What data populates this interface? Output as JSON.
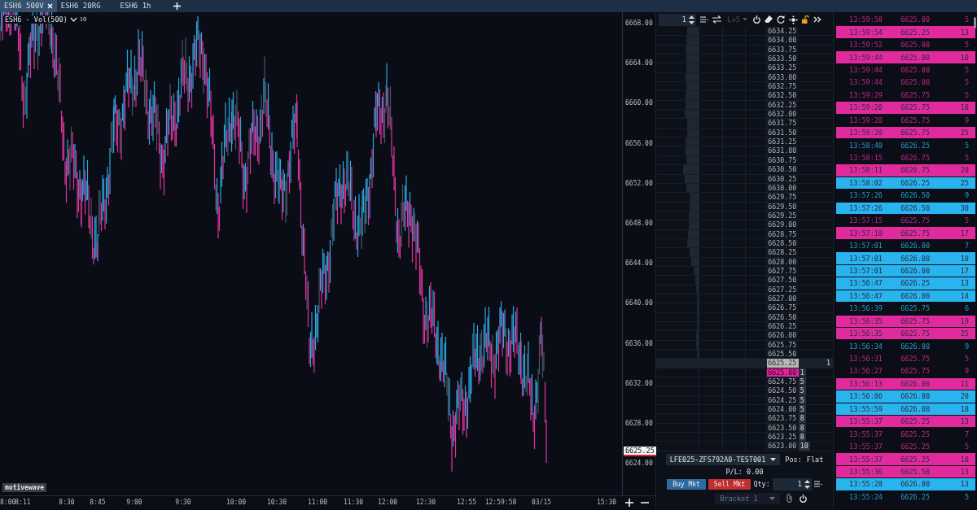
{
  "tabs": [
    {
      "label": "ESH6 500V",
      "selected": true
    },
    {
      "label": "ESH6 20RG",
      "selected": false
    },
    {
      "label": "ESH6 1h",
      "selected": false
    }
  ],
  "chart": {
    "title": "ESH6 - Vol(500)",
    "bar_setting": "10",
    "brand_label": "motivewave",
    "price_axis": [
      "6668.00",
      "6664.00",
      "6660.00",
      "6656.00",
      "6652.00",
      "6648.00",
      "6644.00",
      "6640.00",
      "6636.00",
      "6632.00",
      "6628.00",
      "6624.00"
    ],
    "last_price_tag": "6625.25",
    "time_axis": [
      "8:00",
      "8:11",
      "8:30",
      "8:45",
      "9:00",
      "9:30",
      "10:00",
      "10:30",
      "11:00",
      "11:30",
      "12:00",
      "12:30",
      "12:55",
      "12:59:58",
      "03/15",
      "15:30"
    ]
  },
  "dom": {
    "quantity": "1",
    "depth_mode": "L+5",
    "rows": [
      {
        "price": "6634.25",
        "level": 0.27,
        "last_trade": false,
        "best_bid": false
      },
      {
        "price": "6634.00",
        "level": 0.28,
        "last_trade": false,
        "best_bid": false
      },
      {
        "price": "6633.75",
        "level": 0.3,
        "last_trade": false,
        "best_bid": false
      },
      {
        "price": "6633.50",
        "level": 0.28,
        "last_trade": false,
        "best_bid": false
      },
      {
        "price": "6633.25",
        "level": 0.29,
        "last_trade": false,
        "best_bid": false
      },
      {
        "price": "6633.00",
        "level": 0.3,
        "last_trade": false,
        "best_bid": false
      },
      {
        "price": "6632.75",
        "level": 0.28,
        "last_trade": false,
        "best_bid": false
      },
      {
        "price": "6632.50",
        "level": 0.3,
        "last_trade": false,
        "best_bid": false
      },
      {
        "price": "6632.25",
        "level": 0.3,
        "last_trade": false,
        "best_bid": false
      },
      {
        "price": "6632.00",
        "level": 0.32,
        "last_trade": false,
        "best_bid": false
      },
      {
        "price": "6631.75",
        "level": 0.27,
        "last_trade": false,
        "best_bid": false
      },
      {
        "price": "6631.50",
        "level": 0.27,
        "last_trade": false,
        "best_bid": false
      },
      {
        "price": "6631.25",
        "level": 0.3,
        "last_trade": false,
        "best_bid": false
      },
      {
        "price": "6631.00",
        "level": 0.31,
        "last_trade": false,
        "best_bid": false
      },
      {
        "price": "6630.75",
        "level": 0.29,
        "last_trade": false,
        "best_bid": false
      },
      {
        "price": "6630.50",
        "level": 0.36,
        "last_trade": false,
        "best_bid": false
      },
      {
        "price": "6630.25",
        "level": 0.33,
        "last_trade": false,
        "best_bid": false
      },
      {
        "price": "6630.00",
        "level": 0.28,
        "last_trade": false,
        "best_bid": false
      },
      {
        "price": "6629.75",
        "level": 0.21,
        "last_trade": false,
        "best_bid": false
      },
      {
        "price": "6629.50",
        "level": 0.21,
        "last_trade": false,
        "best_bid": false
      },
      {
        "price": "6629.25",
        "level": 0.22,
        "last_trade": false,
        "best_bid": false
      },
      {
        "price": "6629.00",
        "level": 0.23,
        "last_trade": false,
        "best_bid": false
      },
      {
        "price": "6628.75",
        "level": 0.25,
        "last_trade": false,
        "best_bid": false
      },
      {
        "price": "6628.50",
        "level": 0.27,
        "last_trade": false,
        "best_bid": false
      },
      {
        "price": "6628.25",
        "level": 0.2,
        "last_trade": false,
        "best_bid": false
      },
      {
        "price": "6628.00",
        "level": 0.16,
        "last_trade": false,
        "best_bid": false
      },
      {
        "price": "6627.75",
        "level": 0.12,
        "last_trade": false,
        "best_bid": false
      },
      {
        "price": "6627.50",
        "level": 0.08,
        "last_trade": false,
        "best_bid": false
      },
      {
        "price": "6627.25",
        "level": 0.05,
        "last_trade": false,
        "best_bid": false
      },
      {
        "price": "6627.00",
        "level": 0.03,
        "last_trade": false,
        "best_bid": false
      },
      {
        "price": "6626.75",
        "level": 0.03,
        "last_trade": false,
        "best_bid": false
      },
      {
        "price": "6626.50",
        "level": 0.03,
        "last_trade": false,
        "best_bid": false
      },
      {
        "price": "6626.25",
        "level": 0.03,
        "last_trade": false,
        "best_bid": false
      },
      {
        "price": "6626.00",
        "level": 0.05,
        "last_trade": false,
        "best_bid": false
      },
      {
        "price": "6625.75",
        "level": 0.05,
        "last_trade": false,
        "best_bid": false
      },
      {
        "price": "6625.50",
        "level": 0.03,
        "last_trade": false,
        "best_bid": false
      },
      {
        "price": "6625.25",
        "ask": "1",
        "last_trade": true,
        "best_bid": false
      },
      {
        "price": "6625.00",
        "bid": "1",
        "last_trade": false,
        "best_bid": true
      },
      {
        "price": "6624.75",
        "bid": "5",
        "last_trade": false,
        "best_bid": false
      },
      {
        "price": "6624.50",
        "bid": "5",
        "last_trade": false,
        "best_bid": false
      },
      {
        "price": "6624.25",
        "bid": "5",
        "last_trade": false,
        "best_bid": false
      },
      {
        "price": "6624.00",
        "bid": "5",
        "last_trade": false,
        "best_bid": false
      },
      {
        "price": "6623.75",
        "bid": "8",
        "last_trade": false,
        "best_bid": false
      },
      {
        "price": "6623.50",
        "bid": "8",
        "last_trade": false,
        "best_bid": false
      },
      {
        "price": "6623.25",
        "bid": "8",
        "last_trade": false,
        "best_bid": false
      },
      {
        "price": "6623.00",
        "bid": "10",
        "last_trade": false,
        "best_bid": false
      }
    ],
    "account": "LFE025-ZFS792A0-TEST001",
    "position_label": "Pos:",
    "position": "Flat",
    "pnl": "P/L: 0.00",
    "buy_button": "Buy Mkt",
    "sell_button": "Sell Mkt",
    "qty_label": "Qty:",
    "order_qty": "1",
    "bracket": "Bracket 1"
  },
  "time_and_sales": [
    {
      "time": "13:59:58",
      "price": "6625.00",
      "size": "5",
      "buy": false,
      "large": false
    },
    {
      "time": "13:59:54",
      "price": "6625.25",
      "size": "13",
      "buy": false,
      "large": true
    },
    {
      "time": "13:59:52",
      "price": "6625.00",
      "size": "5",
      "buy": false,
      "large": false
    },
    {
      "time": "13:59:44",
      "price": "6625.00",
      "size": "10",
      "buy": false,
      "large": true
    },
    {
      "time": "13:59:44",
      "price": "6625.00",
      "size": "5",
      "buy": false,
      "large": false
    },
    {
      "time": "13:59:44",
      "price": "6625.00",
      "size": "5",
      "buy": false,
      "large": false
    },
    {
      "time": "13:59:29",
      "price": "6625.75",
      "size": "5",
      "buy": false,
      "large": false
    },
    {
      "time": "13:59:20",
      "price": "6625.75",
      "size": "10",
      "buy": false,
      "large": true
    },
    {
      "time": "13:59:20",
      "price": "6625.75",
      "size": "9",
      "buy": false,
      "large": false
    },
    {
      "time": "13:59:20",
      "price": "6625.75",
      "size": "25",
      "buy": false,
      "large": true
    },
    {
      "time": "13:58:40",
      "price": "6626.25",
      "size": "5",
      "buy": true,
      "large": false
    },
    {
      "time": "13:58:15",
      "price": "6626.75",
      "size": "5",
      "buy": false,
      "large": false
    },
    {
      "time": "13:58:11",
      "price": "6626.75",
      "size": "20",
      "buy": false,
      "large": true
    },
    {
      "time": "13:58:02",
      "price": "6626.25",
      "size": "25",
      "buy": true,
      "large": true
    },
    {
      "time": "13:57:26",
      "price": "6626.50",
      "size": "9",
      "buy": true,
      "large": false
    },
    {
      "time": "13:57:26",
      "price": "6626.50",
      "size": "30",
      "buy": true,
      "large": true
    },
    {
      "time": "13:57:15",
      "price": "6625.75",
      "size": "5",
      "buy": false,
      "large": false
    },
    {
      "time": "13:57:10",
      "price": "6625.75",
      "size": "17",
      "buy": false,
      "large": true
    },
    {
      "time": "13:57:01",
      "price": "6626.00",
      "size": "7",
      "buy": true,
      "large": false
    },
    {
      "time": "13:57:01",
      "price": "6626.00",
      "size": "10",
      "buy": true,
      "large": true
    },
    {
      "time": "13:57:01",
      "price": "6626.00",
      "size": "17",
      "buy": true,
      "large": true
    },
    {
      "time": "13:56:47",
      "price": "6626.25",
      "size": "13",
      "buy": true,
      "large": true
    },
    {
      "time": "13:56:47",
      "price": "6626.00",
      "size": "14",
      "buy": true,
      "large": true
    },
    {
      "time": "13:56:39",
      "price": "6625.75",
      "size": "6",
      "buy": true,
      "large": false
    },
    {
      "time": "13:56:35",
      "price": "6625.75",
      "size": "19",
      "buy": false,
      "large": true
    },
    {
      "time": "13:56:35",
      "price": "6625.75",
      "size": "25",
      "buy": false,
      "large": true
    },
    {
      "time": "13:56:34",
      "price": "6626.00",
      "size": "9",
      "buy": true,
      "large": false
    },
    {
      "time": "13:56:31",
      "price": "6625.75",
      "size": "5",
      "buy": false,
      "large": false
    },
    {
      "time": "13:56:27",
      "price": "6625.75",
      "size": "9",
      "buy": false,
      "large": false
    },
    {
      "time": "13:56:13",
      "price": "6626.00",
      "size": "11",
      "buy": false,
      "large": true
    },
    {
      "time": "13:56:06",
      "price": "6626.00",
      "size": "20",
      "buy": true,
      "large": true
    },
    {
      "time": "13:55:59",
      "price": "6626.00",
      "size": "18",
      "buy": true,
      "large": true
    },
    {
      "time": "13:55:37",
      "price": "6625.25",
      "size": "13",
      "buy": false,
      "large": true
    },
    {
      "time": "13:55:37",
      "price": "6625.25",
      "size": "7",
      "buy": false,
      "large": false
    },
    {
      "time": "13:55:37",
      "price": "6625.25",
      "size": "5",
      "buy": false,
      "large": false
    },
    {
      "time": "13:55:37",
      "price": "6625.25",
      "size": "10",
      "buy": false,
      "large": true
    },
    {
      "time": "13:55:36",
      "price": "6625.50",
      "size": "13",
      "buy": false,
      "large": true
    },
    {
      "time": "13:55:28",
      "price": "6626.00",
      "size": "13",
      "buy": true,
      "large": true
    },
    {
      "time": "13:55:24",
      "price": "6626.25",
      "size": "5",
      "buy": true,
      "large": false
    }
  ]
}
